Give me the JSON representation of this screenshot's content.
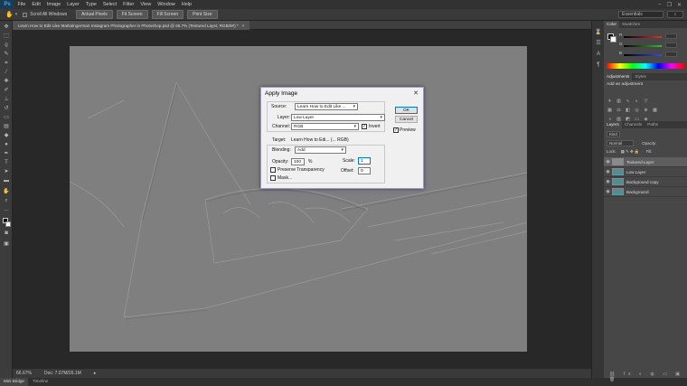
{
  "menubar": {
    "logo": "Ps",
    "items": [
      "File",
      "Edit",
      "Image",
      "Layer",
      "Type",
      "Select",
      "Filter",
      "View",
      "Window",
      "Help"
    ]
  },
  "options": {
    "scroll_all_label": "Scroll All Windows",
    "buttons": [
      "Actual Pixels",
      "Fit Screen",
      "Fill Screen",
      "Print Size"
    ],
    "workspace": "Essentials"
  },
  "document": {
    "tab_title": "Learn How to Edit Like Markalngerman Instagram Photographer in Photoshop.psd @ 66.7% (Textured Layer, RGB/8#) *"
  },
  "status": {
    "zoom": "66.67%",
    "doc": "Doc: 7.07M/26.1M"
  },
  "bottom_tabs": [
    "Mini Bridge",
    "Timeline"
  ],
  "dialog": {
    "title": "Apply Image",
    "source_label": "Source:",
    "source_value": "Learn How to Edit Like ...",
    "layer_label": "Layer:",
    "layer_value": "Low Layer",
    "channel_label": "Channel:",
    "channel_value": "RGB",
    "invert_label": "Invert",
    "target_label": "Target:",
    "target_value": "Learn How to Edi... (... RGB)",
    "blending_label": "Blending:",
    "blending_value": "Add",
    "opacity_label": "Opacity:",
    "opacity_value": "100",
    "opacity_unit": "%",
    "scale_label": "Scale:",
    "scale_value": "1",
    "offset_label": "Offset:",
    "offset_value": "0",
    "preserve_label": "Preserve Transparency",
    "mask_label": "Mask...",
    "ok_label": "OK",
    "cancel_label": "Cancel",
    "preview_label": "Preview"
  },
  "color_panel": {
    "tabs": [
      "Color",
      "Swatches"
    ],
    "channels": [
      "R",
      "G",
      "B"
    ],
    "slider_colors": [
      "#e03030",
      "#30c030",
      "#3050e0"
    ]
  },
  "adjustments_panel": {
    "tabs": [
      "Adjustments",
      "Styles"
    ],
    "hint": "Add an adjustment"
  },
  "layers_panel": {
    "tabs": [
      "Layers",
      "Channels",
      "Paths"
    ],
    "kind": "Kind",
    "blend_mode": "Normal",
    "opacity_label": "Opacity:",
    "lock_label": "Lock:",
    "fill_label": "Fill:",
    "layers": [
      {
        "name": "Textured Layer",
        "selected": true
      },
      {
        "name": "Low Layer",
        "selected": false
      },
      {
        "name": "Background copy",
        "selected": false
      },
      {
        "name": "Background",
        "selected": false
      }
    ]
  }
}
